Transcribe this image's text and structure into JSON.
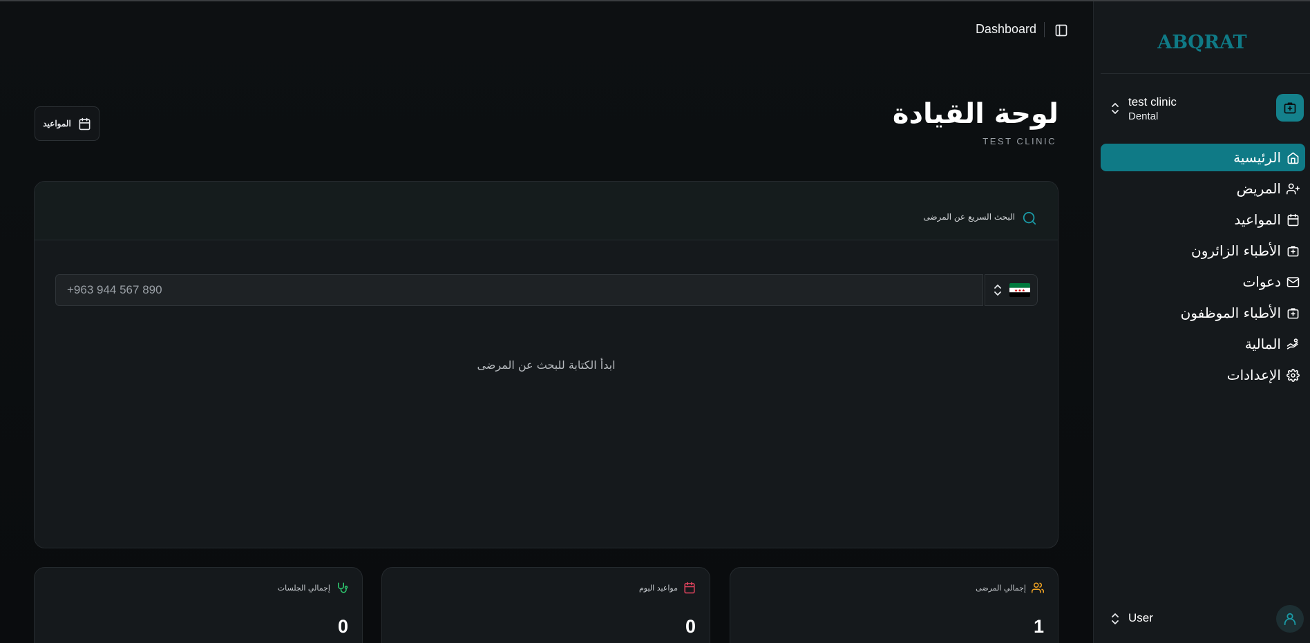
{
  "topbar": {
    "breadcrumb": "Dashboard",
    "toggle_icon": "sidebar-toggle-icon"
  },
  "header": {
    "title": "لوحة القيادة",
    "subtitle": "TEST CLINIC",
    "appointments_button": "المواعيد"
  },
  "search": {
    "title": "البحث السريع عن المرضى",
    "phone_placeholder": "+963 944 567 890",
    "country": "Syria",
    "empty_hint": "ابدأ الكتابة للبحث عن المرضى"
  },
  "stats": [
    {
      "label": "إجمالي المرضى",
      "value": "1",
      "icon": "users-icon",
      "color": "#f5a623"
    },
    {
      "label": "مواعيد اليوم",
      "value": "0",
      "icon": "calendar-icon",
      "color": "#e94560"
    },
    {
      "label": "إجمالي الجلسات",
      "value": "0",
      "icon": "stethoscope-icon",
      "color": "#2ecc71"
    }
  ],
  "sidebar": {
    "logo": "ABQRAT",
    "clinic": {
      "name": "test clinic",
      "type": "Dental"
    },
    "items": [
      {
        "label": "الرئيسية",
        "icon": "home-icon",
        "active": true
      },
      {
        "label": "المريض",
        "icon": "user-plus-icon"
      },
      {
        "label": "المواعيد",
        "icon": "calendar-icon"
      },
      {
        "label": "الأطباء الزائرون",
        "icon": "medical-bag-icon"
      },
      {
        "label": "دعوات",
        "icon": "mail-icon"
      },
      {
        "label": "الأطباء الموظفون",
        "icon": "medical-bag-icon"
      },
      {
        "label": "المالية",
        "icon": "hand-coins-icon"
      },
      {
        "label": "الإعدادات",
        "icon": "gear-icon"
      }
    ],
    "user": {
      "name": "User"
    }
  },
  "colors": {
    "accent": "#0f7a86",
    "background": "#0b0d0f",
    "card": "#15191c"
  }
}
